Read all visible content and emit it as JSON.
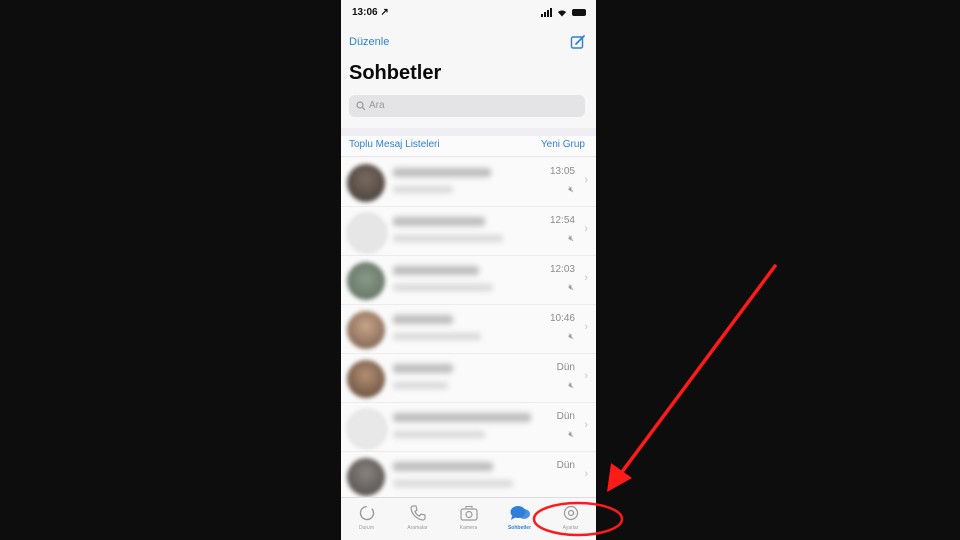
{
  "status_bar": {
    "time": "13:06 ↗"
  },
  "header": {
    "edit_label": "Düzenle",
    "title": "Sohbetler",
    "compose_icon": "compose-icon"
  },
  "search": {
    "placeholder": "Ara"
  },
  "links": {
    "broadcast": "Toplu Mesaj Listeleri",
    "new_group": "Yeni Grup"
  },
  "chats": [
    {
      "time": "13:05"
    },
    {
      "time": "12:54"
    },
    {
      "time": "12:03"
    },
    {
      "time": "10:46"
    },
    {
      "time": "Dün"
    },
    {
      "time": "Dün"
    },
    {
      "time": "Dün"
    }
  ],
  "tabs": [
    {
      "label": "Durum",
      "icon": "status-icon"
    },
    {
      "label": "Aramalar",
      "icon": "phone-icon"
    },
    {
      "label": "Kamera",
      "icon": "camera-icon"
    },
    {
      "label": "Sohbetler",
      "icon": "chats-icon"
    },
    {
      "label": "Ayarlar",
      "icon": "gear-icon"
    }
  ],
  "colors": {
    "accent": "#2f7fd8",
    "annotation": "#ff1a1a"
  }
}
